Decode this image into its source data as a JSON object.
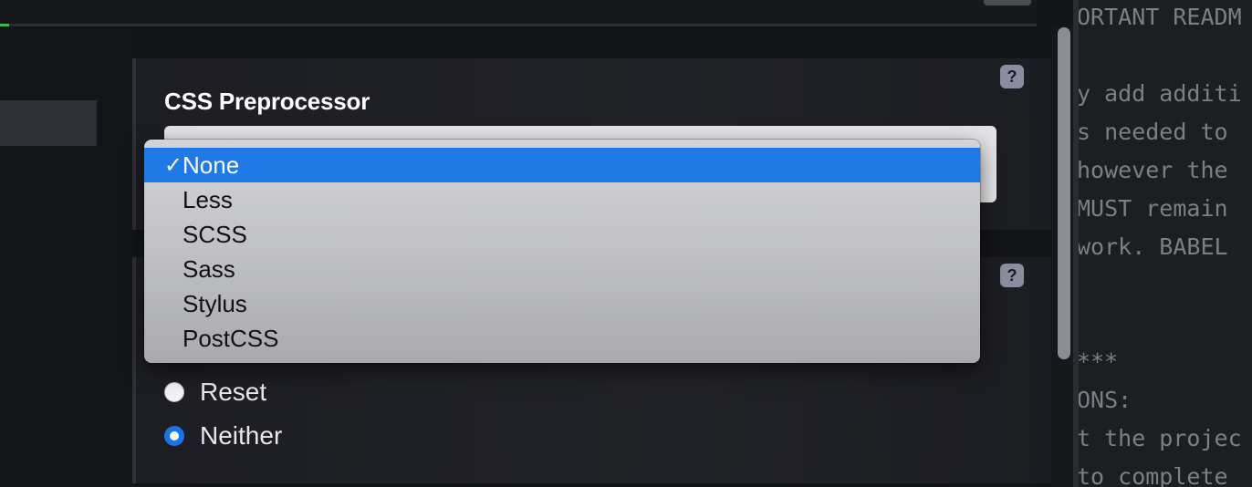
{
  "form": {
    "css_preprocessor": {
      "label": "CSS Preprocessor",
      "help_icon": "?",
      "options": [
        {
          "label": "None",
          "selected": true
        },
        {
          "label": "Less",
          "selected": false
        },
        {
          "label": "SCSS",
          "selected": false
        },
        {
          "label": "Sass",
          "selected": false
        },
        {
          "label": "Stylus",
          "selected": false
        },
        {
          "label": "PostCSS",
          "selected": false
        }
      ],
      "check_mark": "✓"
    },
    "css_reset": {
      "help_icon": "?",
      "options": [
        {
          "label": "Reset",
          "checked": false
        },
        {
          "label": "Neither",
          "checked": true
        }
      ]
    }
  },
  "code_pane": {
    "lines": [
      "ORTANT READM",
      "",
      "y add additi",
      "s needed to",
      "however the",
      "MUST remain",
      "work. BABEL",
      "",
      "",
      "***",
      "ONS:",
      "t the projec",
      "to complete"
    ]
  },
  "colors": {
    "accent": "#1f7ae8",
    "progress": "#3fb950"
  }
}
